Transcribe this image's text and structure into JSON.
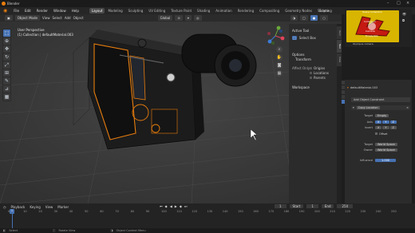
{
  "app": {
    "title": "Blender"
  },
  "menu": [
    "File",
    "Edit",
    "Render",
    "Window",
    "Help"
  ],
  "workspace_tabs": [
    {
      "label": "Layout",
      "active": true
    },
    {
      "label": "Modeling",
      "active": false
    },
    {
      "label": "Sculpting",
      "active": false
    },
    {
      "label": "UV Editing",
      "active": false
    },
    {
      "label": "Texture Paint",
      "active": false
    },
    {
      "label": "Shading",
      "active": false
    },
    {
      "label": "Animation",
      "active": false
    },
    {
      "label": "Rendering",
      "active": false
    },
    {
      "label": "Compositing",
      "active": false
    },
    {
      "label": "Geometry Nodes",
      "active": false
    },
    {
      "label": "Scripting",
      "active": false
    }
  ],
  "scene_name": "Scene",
  "viewport_header": {
    "mode": "Object Mode",
    "menus": [
      "View",
      "Select",
      "Add",
      "Object"
    ],
    "transform_orientation": "Global"
  },
  "viewport_info": {
    "line1": "User Perspective",
    "line2": "(1) Collection | defaultMaterial.003"
  },
  "npanel": {
    "active_tool_header": "Active Tool",
    "select_box": "Select Box",
    "options_header": "Options",
    "transform_header": "Transform",
    "affect_only": "Affect Only",
    "origins": "Origins",
    "locations": "Locations",
    "parents": "Parents",
    "workspace_header": "Workspace",
    "tabs": [
      "Item",
      "Tool",
      "View"
    ]
  },
  "outliner": {
    "rows": [
      "Scene Collection",
      "Collection",
      "Camera",
      "Empty.001",
      "Olympus camera"
    ]
  },
  "properties": {
    "object_name": "defaultMaterial.003",
    "add_constraint": "Add Object Constraint",
    "constraint_name": "Copy Location",
    "target_label": "Target",
    "target_value": "Empty",
    "axis_label": "Axis",
    "axis": [
      "X",
      "Y",
      "Z"
    ],
    "invert_label": "Invert",
    "offset_label": "Offset",
    "target_space_label": "Target",
    "target_space": "World Space",
    "owner_label": "Owner",
    "owner_space": "World Space",
    "influence_label": "Influence",
    "influence_value": "1.000"
  },
  "timeline": {
    "menus": [
      "Playback",
      "Keying",
      "View",
      "Marker"
    ],
    "current_frame": "1",
    "start_label": "Start",
    "start_value": "1",
    "end_label": "End",
    "end_value": "250",
    "ticks": [
      "0",
      "10",
      "20",
      "30",
      "40",
      "50",
      "60",
      "70",
      "80",
      "90",
      "100",
      "110",
      "120",
      "130",
      "140",
      "150",
      "160",
      "170",
      "180",
      "190",
      "200",
      "210",
      "220",
      "230",
      "240",
      "250"
    ]
  },
  "statusbar": {
    "select": "Select",
    "rotate": "Rotate View",
    "context": "Object Context Menu"
  },
  "colors": {
    "accent": "#4772b3",
    "selection": "#e87d0d",
    "viewport_bg": "#3b3b3b"
  }
}
